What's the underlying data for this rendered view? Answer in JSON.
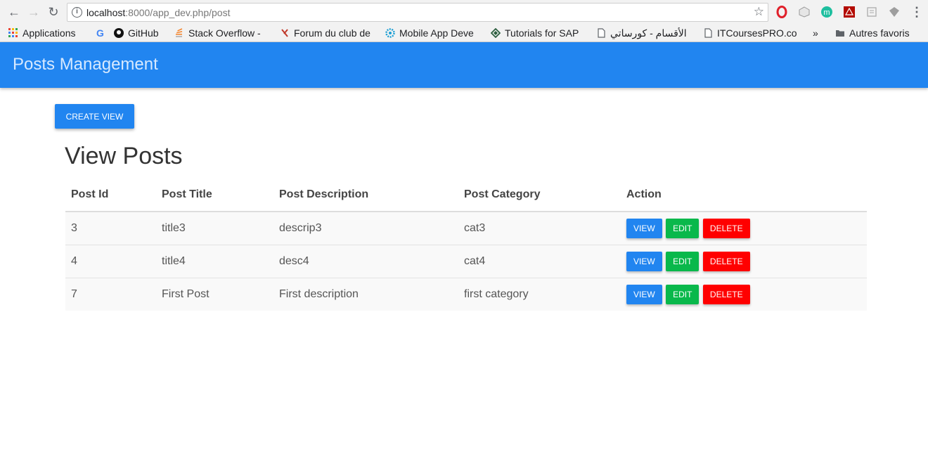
{
  "browser": {
    "url_host": "localhost",
    "url_rest": ":8000/app_dev.php/post"
  },
  "bookmarks": {
    "items": [
      {
        "label": "Applications"
      },
      {
        "label": "GitHub"
      },
      {
        "label": "Stack Overflow -"
      },
      {
        "label": "Forum du club de"
      },
      {
        "label": "Mobile App Deve"
      },
      {
        "label": "Tutorials for SAP"
      },
      {
        "label": "الأقسام - كورساتي"
      },
      {
        "label": "ITCoursesPRO.co"
      }
    ],
    "overflow": "»",
    "other": "Autres favoris"
  },
  "app": {
    "brand": "Posts Management",
    "create_button": "CREATE VIEW",
    "title": "View Posts"
  },
  "table": {
    "headers": [
      "Post Id",
      "Post Title",
      "Post Description",
      "Post Category",
      "Action"
    ],
    "rows": [
      {
        "id": "3",
        "title": "title3",
        "description": "descrip3",
        "category": "cat3"
      },
      {
        "id": "4",
        "title": "title4",
        "description": "desc4",
        "category": "cat4"
      },
      {
        "id": "7",
        "title": "First Post",
        "description": "First description",
        "category": "first category"
      }
    ],
    "actions": {
      "view": "VIEW",
      "edit": "EDIT",
      "delete": "DELETE"
    }
  },
  "colors": {
    "primary": "#2185f0",
    "edit": "#09b84b",
    "delete": "#ff0000"
  }
}
